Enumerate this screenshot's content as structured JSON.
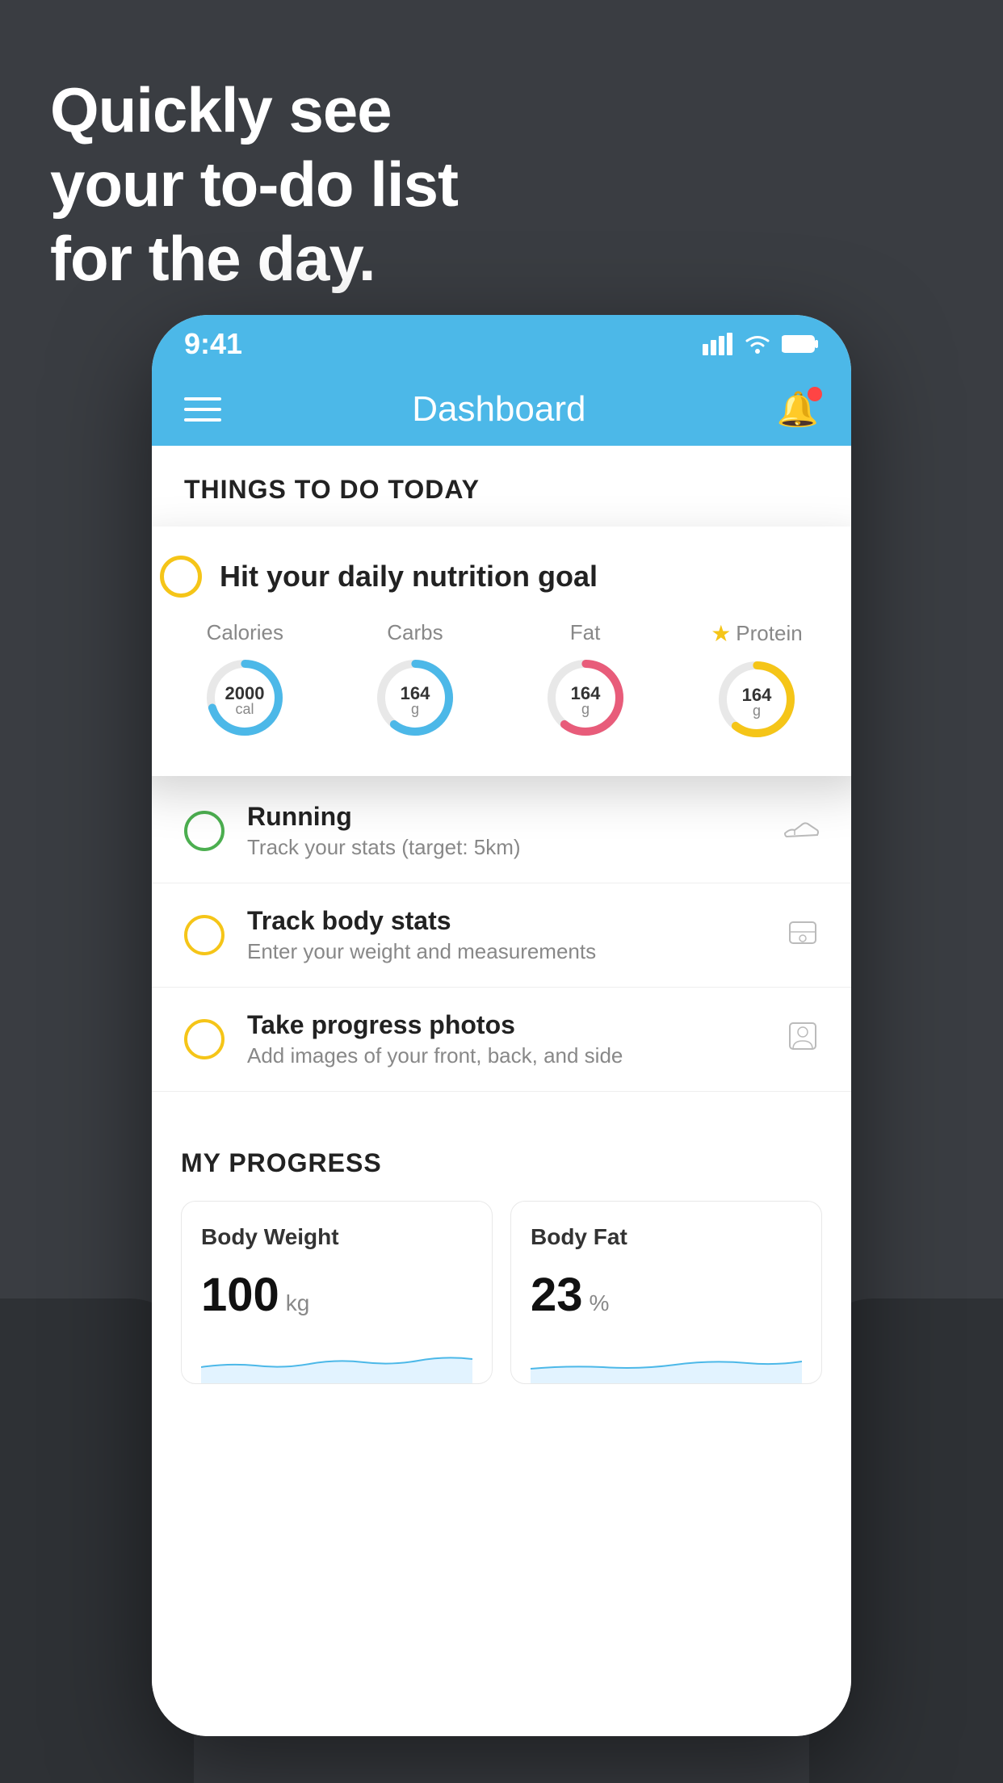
{
  "headline": {
    "line1": "Quickly see",
    "line2": "your to-do list",
    "line3": "for the day."
  },
  "status_bar": {
    "time": "9:41",
    "signal": "▌▌▌▌",
    "wifi": "wifi",
    "battery": "battery"
  },
  "navbar": {
    "title": "Dashboard"
  },
  "things_to_do": {
    "section_label": "THINGS TO DO TODAY"
  },
  "nutrition_card": {
    "title": "Hit your daily nutrition goal",
    "metrics": [
      {
        "label": "Calories",
        "value": "2000",
        "unit": "cal",
        "color": "#4cb8e8",
        "star": false
      },
      {
        "label": "Carbs",
        "value": "164",
        "unit": "g",
        "color": "#4cb8e8",
        "star": false
      },
      {
        "label": "Fat",
        "value": "164",
        "unit": "g",
        "color": "#e85c7a",
        "star": false
      },
      {
        "label": "Protein",
        "value": "164",
        "unit": "g",
        "color": "#f5c518",
        "star": true
      }
    ]
  },
  "todo_items": [
    {
      "title": "Running",
      "subtitle": "Track your stats (target: 5km)",
      "status": "green",
      "icon": "shoe"
    },
    {
      "title": "Track body stats",
      "subtitle": "Enter your weight and measurements",
      "status": "yellow",
      "icon": "scale"
    },
    {
      "title": "Take progress photos",
      "subtitle": "Add images of your front, back, and side",
      "status": "yellow",
      "icon": "person"
    }
  ],
  "my_progress": {
    "section_label": "MY PROGRESS",
    "cards": [
      {
        "title": "Body Weight",
        "value": "100",
        "unit": "kg"
      },
      {
        "title": "Body Fat",
        "value": "23",
        "unit": "%"
      }
    ]
  }
}
